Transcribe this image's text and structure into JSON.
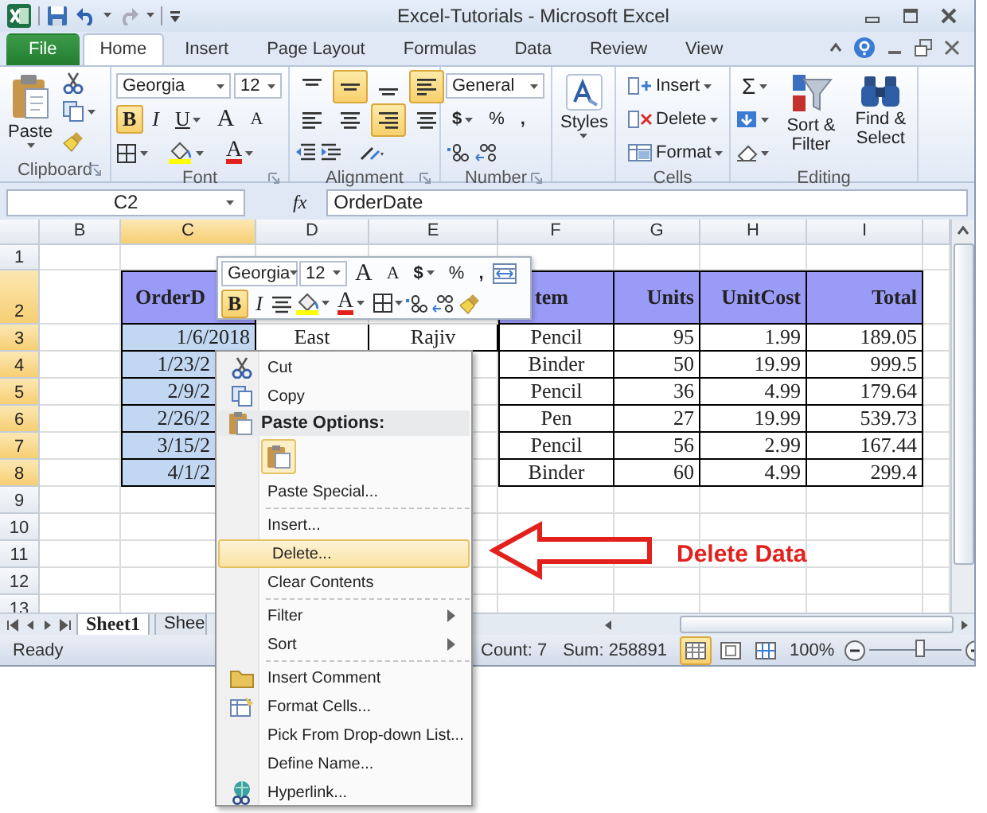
{
  "title_bar": {
    "title": "Excel-Tutorials - Microsoft Excel"
  },
  "tabs": [
    {
      "label": "File",
      "kind": "backstage",
      "selected": false
    },
    {
      "label": "Home",
      "kind": "tab",
      "selected": true
    },
    {
      "label": "Insert",
      "kind": "tab",
      "selected": false
    },
    {
      "label": "Page Layout",
      "kind": "tab",
      "selected": false
    },
    {
      "label": "Formulas",
      "kind": "tab",
      "selected": false
    },
    {
      "label": "Data",
      "kind": "tab",
      "selected": false
    },
    {
      "label": "Review",
      "kind": "tab",
      "selected": false
    },
    {
      "label": "View",
      "kind": "tab",
      "selected": false
    }
  ],
  "ribbon": {
    "clipboard": {
      "paste": "Paste",
      "group": "Clipboard"
    },
    "font": {
      "name": "Georgia",
      "size": "12",
      "bold": "B",
      "bold_on": true,
      "italic": "I",
      "underline": "U",
      "grow": "A",
      "shrink": "A",
      "font_color_button": "A",
      "group": "Font"
    },
    "alignment": {
      "buttons": [
        {
          "on": false
        },
        {
          "on": true
        },
        {
          "on": false
        },
        {
          "on": true
        },
        {
          "on": false
        },
        {
          "on": false
        },
        {
          "on": true
        },
        {
          "on": false
        }
      ],
      "group": "Alignment"
    },
    "number": {
      "format": "General",
      "currency": "$",
      "percent": "%",
      "comma": ",",
      "group": "Number"
    },
    "styles": {
      "label": "Styles"
    },
    "cells": {
      "items": [
        "Insert",
        "Delete",
        "Format"
      ],
      "group": "Cells"
    },
    "editing": {
      "sum": "Σ",
      "sort": "Sort & Filter",
      "find": "Find & Select",
      "group": "Editing"
    }
  },
  "formula_bar": {
    "name_box": "C2",
    "fx": "fx",
    "formula": "OrderDate"
  },
  "sheet": {
    "columns": [
      {
        "label": "B",
        "selected": false
      },
      {
        "label": "C",
        "selected": true
      },
      {
        "label": "D",
        "selected": false
      },
      {
        "label": "E",
        "selected": false
      },
      {
        "label": "F",
        "selected": false
      },
      {
        "label": "G",
        "selected": false
      },
      {
        "label": "H",
        "selected": false
      },
      {
        "label": "I",
        "selected": false
      }
    ],
    "rows": [
      {
        "label": "1",
        "selected": false
      },
      {
        "label": "2",
        "selected": true,
        "cells": [
          null,
          "OrderD",
          null,
          null,
          "tem",
          "Units",
          "UnitCost",
          "Total"
        ]
      },
      {
        "label": "3",
        "selected": true,
        "cells": [
          null,
          "1/6/2018",
          "East",
          "Rajiv",
          "Pencil",
          "95",
          "1.99",
          "189.05"
        ]
      },
      {
        "label": "4",
        "selected": true,
        "cells": [
          null,
          "1/23/2",
          null,
          null,
          "Binder",
          "50",
          "19.99",
          "999.5"
        ]
      },
      {
        "label": "5",
        "selected": true,
        "cells": [
          null,
          "2/9/2",
          null,
          null,
          "Pencil",
          "36",
          "4.99",
          "179.64"
        ]
      },
      {
        "label": "6",
        "selected": true,
        "cells": [
          null,
          "2/26/2",
          null,
          null,
          "Pen",
          "27",
          "19.99",
          "539.73"
        ]
      },
      {
        "label": "7",
        "selected": true,
        "cells": [
          null,
          "3/15/2",
          null,
          null,
          "Pencil",
          "56",
          "2.99",
          "167.44"
        ]
      },
      {
        "label": "8",
        "selected": true,
        "cells": [
          null,
          "4/1/2",
          null,
          null,
          "Binder",
          "60",
          "4.99",
          "299.4"
        ]
      },
      {
        "label": "9",
        "selected": false
      },
      {
        "label": "10",
        "selected": false
      },
      {
        "label": "11",
        "selected": false
      },
      {
        "label": "12",
        "selected": false
      },
      {
        "label": "13",
        "selected": false
      }
    ]
  },
  "mini_toolbar": {
    "font": "Georgia",
    "size": "12",
    "grow": "A",
    "shrink": "A",
    "currency": "$",
    "percent": "%",
    "comma": ",",
    "bold": "B",
    "bold_on": true,
    "italic": "I",
    "font_color_button": "A"
  },
  "context_menu": {
    "items": [
      {
        "kind": "item",
        "label": "Cut",
        "selected": false
      },
      {
        "kind": "item",
        "label": "Copy",
        "selected": false
      },
      {
        "kind": "header",
        "label": "Paste Options:"
      },
      {
        "kind": "paste-icons"
      },
      {
        "kind": "item",
        "label": "Paste Special...",
        "selected": false
      },
      {
        "kind": "separator"
      },
      {
        "kind": "item",
        "label": "Insert...",
        "selected": false
      },
      {
        "kind": "item",
        "label": "Delete...",
        "selected": true
      },
      {
        "kind": "item",
        "label": "Clear Contents",
        "selected": false
      },
      {
        "kind": "separator"
      },
      {
        "kind": "submenu",
        "label": "Filter",
        "selected": false
      },
      {
        "kind": "submenu",
        "label": "Sort",
        "selected": false
      },
      {
        "kind": "separator"
      },
      {
        "kind": "item",
        "label": "Insert Comment",
        "selected": false
      },
      {
        "kind": "item",
        "label": "Format Cells...",
        "selected": false
      },
      {
        "kind": "item",
        "label": "Pick From Drop-down List...",
        "selected": false
      },
      {
        "kind": "item",
        "label": "Define Name...",
        "selected": false
      },
      {
        "kind": "item",
        "label": "Hyperlink...",
        "selected": false
      }
    ]
  },
  "annotation": {
    "label": "Delete Data"
  },
  "sheet_tabs": [
    {
      "label": "Sheet1",
      "selected": true
    },
    {
      "label": "Shee",
      "selected": false
    }
  ],
  "status_bar": {
    "mode": "Ready",
    "count": "Count: 7",
    "sum": "Sum: 258891",
    "views": [
      {
        "selected": true
      },
      {
        "selected": false
      },
      {
        "selected": false
      }
    ],
    "zoom": "100%",
    "zoom_slider": {
      "level": 0.55
    }
  }
}
